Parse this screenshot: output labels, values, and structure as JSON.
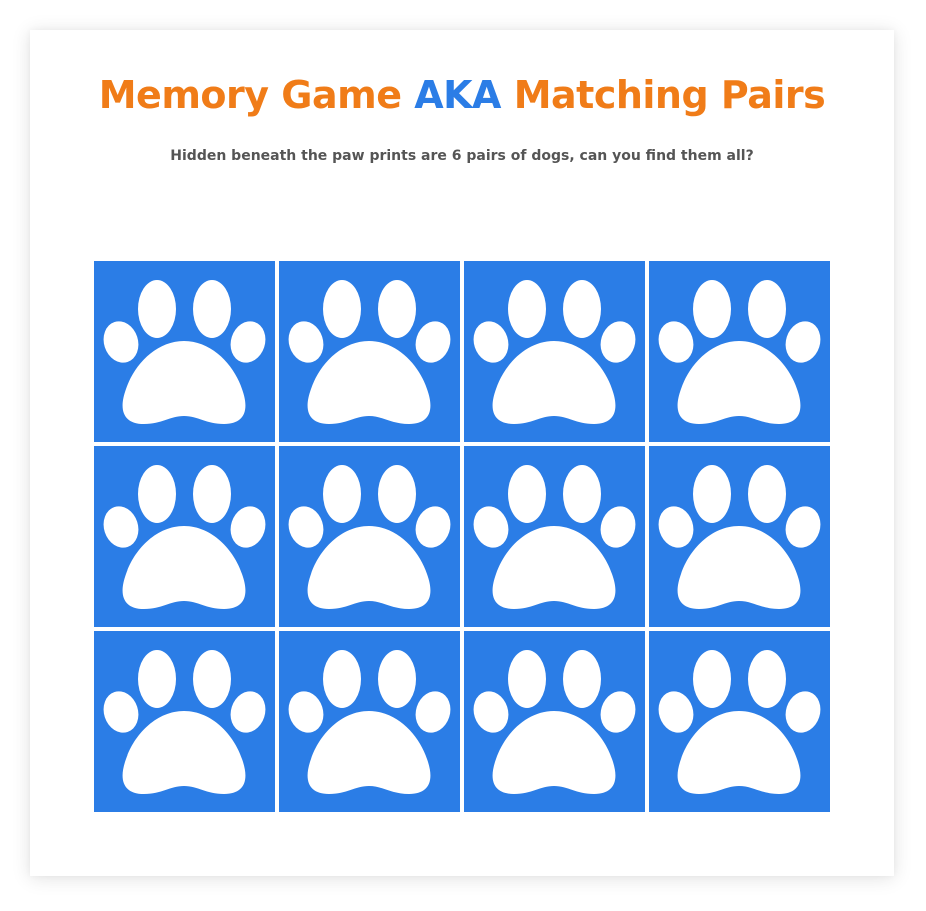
{
  "header": {
    "title_part1": "Memory Game ",
    "title_part2": "AKA",
    "title_part3": " Matching Pairs",
    "subtitle": "Hidden beneath the paw prints are 6 pairs of dogs, can you find them all?"
  },
  "board": {
    "rows": 3,
    "columns": 4,
    "tiles": [
      {
        "state": "face-down",
        "icon": "paw-print-icon"
      },
      {
        "state": "face-down",
        "icon": "paw-print-icon"
      },
      {
        "state": "face-down",
        "icon": "paw-print-icon"
      },
      {
        "state": "face-down",
        "icon": "paw-print-icon"
      },
      {
        "state": "face-down",
        "icon": "paw-print-icon"
      },
      {
        "state": "face-down",
        "icon": "paw-print-icon"
      },
      {
        "state": "face-down",
        "icon": "paw-print-icon"
      },
      {
        "state": "face-down",
        "icon": "paw-print-icon"
      },
      {
        "state": "face-down",
        "icon": "paw-print-icon"
      },
      {
        "state": "face-down",
        "icon": "paw-print-icon"
      },
      {
        "state": "face-down",
        "icon": "paw-print-icon"
      },
      {
        "state": "face-down",
        "icon": "paw-print-icon"
      }
    ]
  },
  "colors": {
    "title_orange": "#f07c18",
    "title_blue": "#2b7de6",
    "tile_blue": "#2b7de6",
    "paw_white": "#ffffff",
    "subtitle_gray": "#555555"
  }
}
